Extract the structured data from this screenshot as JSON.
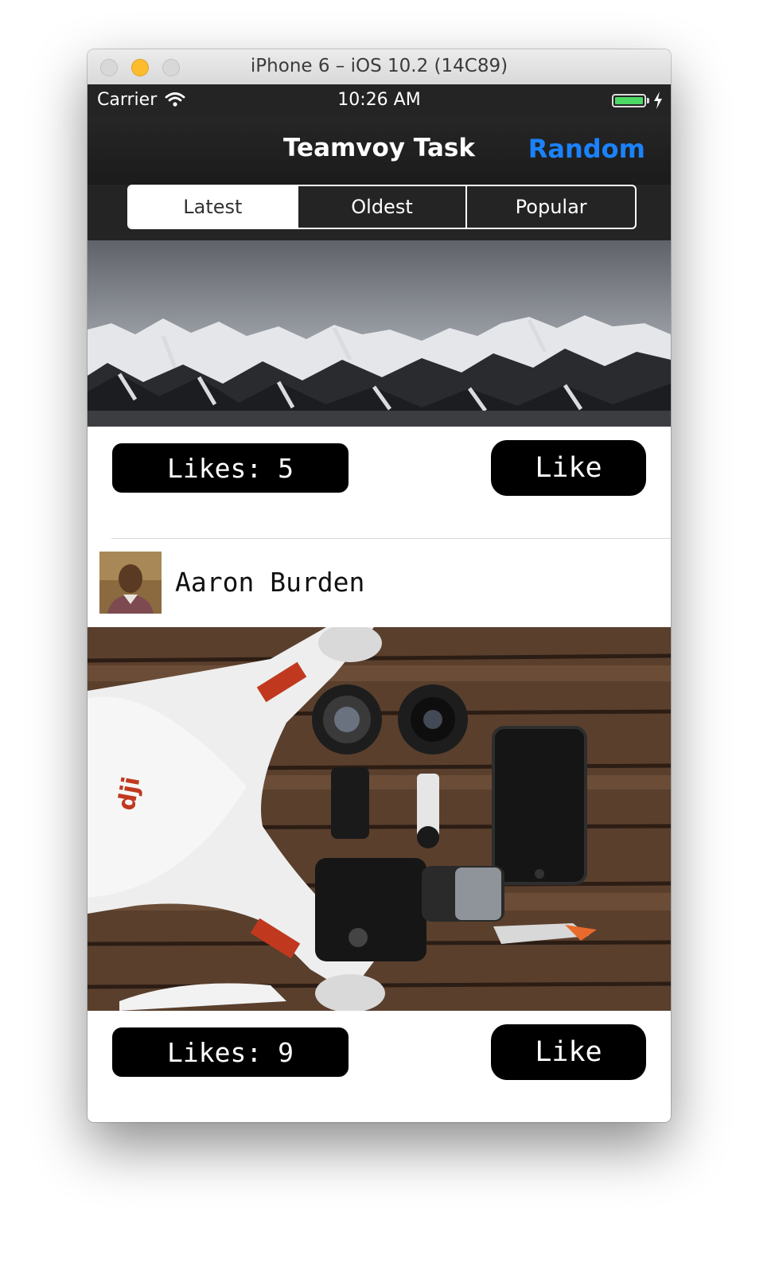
{
  "window": {
    "title": "iPhone 6 – iOS 10.2 (14C89)"
  },
  "status": {
    "carrier": "Carrier",
    "time": "10:26 AM",
    "battery_level": 1.0
  },
  "nav": {
    "title": "Teamvoy Task",
    "right_button": "Random"
  },
  "segments": {
    "items": [
      "Latest",
      "Oldest",
      "Popular"
    ],
    "selected": "Latest"
  },
  "posts": [
    {
      "likes_label": "Likes: 5",
      "like_button": "Like"
    },
    {
      "author": "Aaron Burden",
      "likes_label": "Likes: 9",
      "like_button": "Like"
    }
  ],
  "colors": {
    "accent": "#1a82fb",
    "nav_bg": "#242424",
    "button_bg": "#000000"
  }
}
